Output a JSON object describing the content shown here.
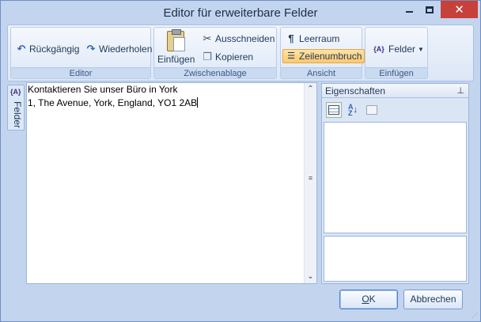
{
  "window": {
    "title": "Editor für erweiterbare Felder"
  },
  "ribbon": {
    "editor_group": {
      "label": "Editor",
      "undo": "Rückgängig",
      "redo": "Wiederholen"
    },
    "clipboard_group": {
      "label": "Zwischenablage",
      "paste": "Einfügen",
      "cut": "Ausschneiden",
      "copy": "Kopieren"
    },
    "view_group": {
      "label": "Ansicht",
      "whitespace": "Leerraum",
      "wordwrap": "Zeilenumbruch"
    },
    "insert_group": {
      "label": "Einfügen",
      "fields": "Felder"
    }
  },
  "side_panel": {
    "icon_text": "{A}",
    "label": "Felder"
  },
  "editor": {
    "lines": [
      "Kontaktieren Sie unser Büro in York",
      "1, The Avenue, York, England, YO1 2AB"
    ]
  },
  "properties": {
    "title": "Eigenschaften"
  },
  "dialog": {
    "ok_first": "O",
    "ok_rest": "K",
    "cancel": "Abbrechen"
  },
  "icons": {
    "undo": "undo-arrow-icon",
    "redo": "redo-arrow-icon",
    "paste": "clipboard-icon",
    "cut": "scissors-icon",
    "copy": "copy-icon",
    "whitespace": "pilcrow-icon",
    "wordwrap": "word-wrap-icon",
    "fields": "field-braces-icon"
  }
}
